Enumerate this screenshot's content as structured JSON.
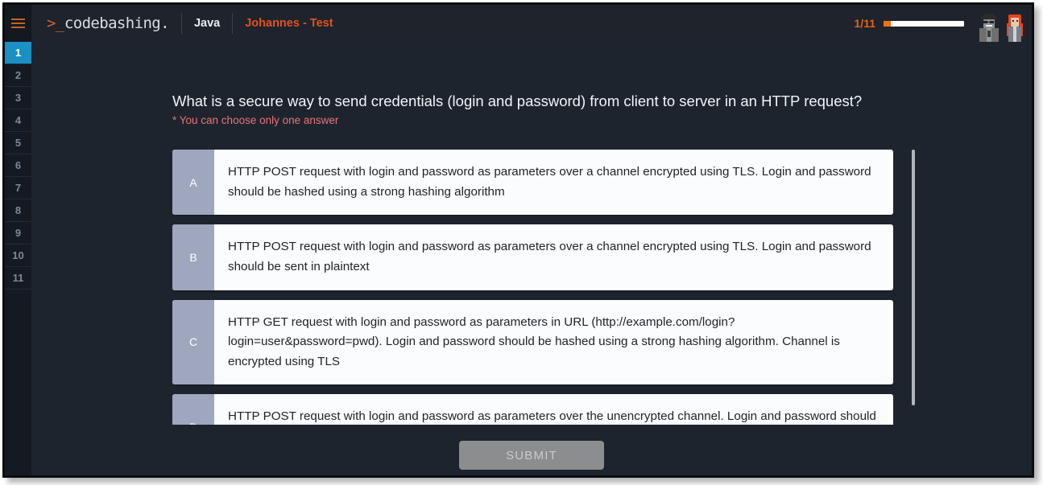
{
  "header": {
    "menu_icon": "hamburger-menu-icon",
    "logo_prompt": ">_",
    "logo_name": "codebashing.",
    "language": "Java",
    "course": "Johannes - Test",
    "progress_label": "1/11",
    "progress_percent": 9,
    "avatars": [
      "hacker-avatar",
      "developer-avatar"
    ]
  },
  "sidebar": {
    "items": [
      {
        "label": "1",
        "active": true
      },
      {
        "label": "2",
        "active": false
      },
      {
        "label": "3",
        "active": false
      },
      {
        "label": "4",
        "active": false
      },
      {
        "label": "5",
        "active": false
      },
      {
        "label": "6",
        "active": false
      },
      {
        "label": "7",
        "active": false
      },
      {
        "label": "8",
        "active": false
      },
      {
        "label": "9",
        "active": false
      },
      {
        "label": "10",
        "active": false
      },
      {
        "label": "11",
        "active": false
      }
    ]
  },
  "quiz": {
    "question": "What is a secure way to send credentials (login and password) from client to server in an HTTP request?",
    "note": "* You can choose only one answer",
    "answers": [
      {
        "letter": "A",
        "text": "HTTP POST request with login and password as parameters over a channel encrypted using TLS. Login and password should be hashed using a strong hashing algorithm"
      },
      {
        "letter": "B",
        "text": "HTTP POST request with login and password as parameters over a channel encrypted using TLS. Login and password should be sent in plaintext"
      },
      {
        "letter": "C",
        "text": "HTTP GET request with login and password as parameters in URL (http://example.com/login?login=user&password=pwd). Login and password should be hashed using a strong hashing algorithm. Channel is encrypted using TLS"
      },
      {
        "letter": "D",
        "text": "HTTP POST request with login and password as parameters over the unencrypted channel. Login and password should be encrypted using a strong encryption algorithm"
      }
    ],
    "submit_label": "SUBMIT"
  },
  "colors": {
    "accent_orange": "#e8601c",
    "active_blue": "#1b90c4",
    "note_red": "#e8737a",
    "letter_badge": "#9fa7bf",
    "page_bg": "#1d242e"
  }
}
